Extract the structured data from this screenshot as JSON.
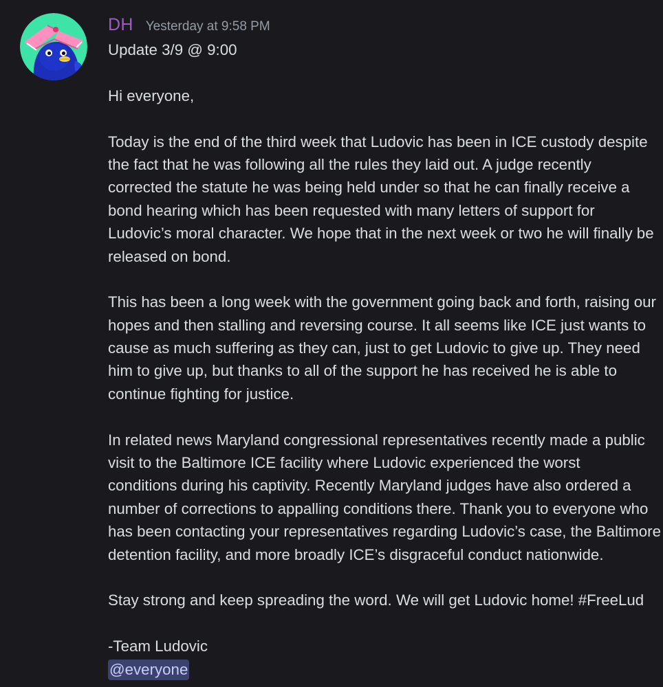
{
  "message": {
    "username": "DH",
    "timestamp": "Yesterday at 9:58 PM",
    "avatar_icon": "penguin-with-book-icon",
    "colors": {
      "background": "#1a1a1e",
      "username": "#a259c7",
      "text": "#dbdee1",
      "timestamp": "#949ba4",
      "mention_bg": "#3c4270",
      "mention_text": "#c9cdfb"
    },
    "title_line": "Update 3/9 @ 9:00",
    "greeting": "Hi everyone,",
    "paragraph1": [
      "Today is the end of the third week that Ludovic has been in ICE custody despite",
      "the fact that he was following all the rules they laid out. A judge recently",
      "corrected the statute he was being held under so that he can finally receive a",
      "bond hearing which has been requested with many letters of support for",
      "Ludovic’s moral character. We hope that in the next week or two he will finally be",
      "released on bond."
    ],
    "paragraph2": [
      "This has been a long week with the government going back and forth, raising our",
      "hopes and then stalling and reversing course. It all seems like ICE just wants to",
      "cause as much suffering as they can, just to get Ludovic to give up. They need",
      "him to give up, but thanks to all of the support he has received he is able to",
      "continue fighting for justice."
    ],
    "paragraph3": [
      "In related news Maryland congressional representatives recently made a public",
      "visit to the Baltimore ICE facility where Ludovic experienced the worst",
      "conditions during his captivity. Recently Maryland judges have also ordered a",
      "number of corrections to appalling conditions there. Thank you to everyone who",
      "has been contacting your representatives regarding Ludovic’s case, the Baltimore",
      "detention facility, and more broadly ICE’s disgraceful conduct nationwide."
    ],
    "closing": "Stay strong and keep spreading the word. We will get Ludovic home! #FreeLud",
    "signature": "-Team Ludovic",
    "mention": "@everyone"
  }
}
